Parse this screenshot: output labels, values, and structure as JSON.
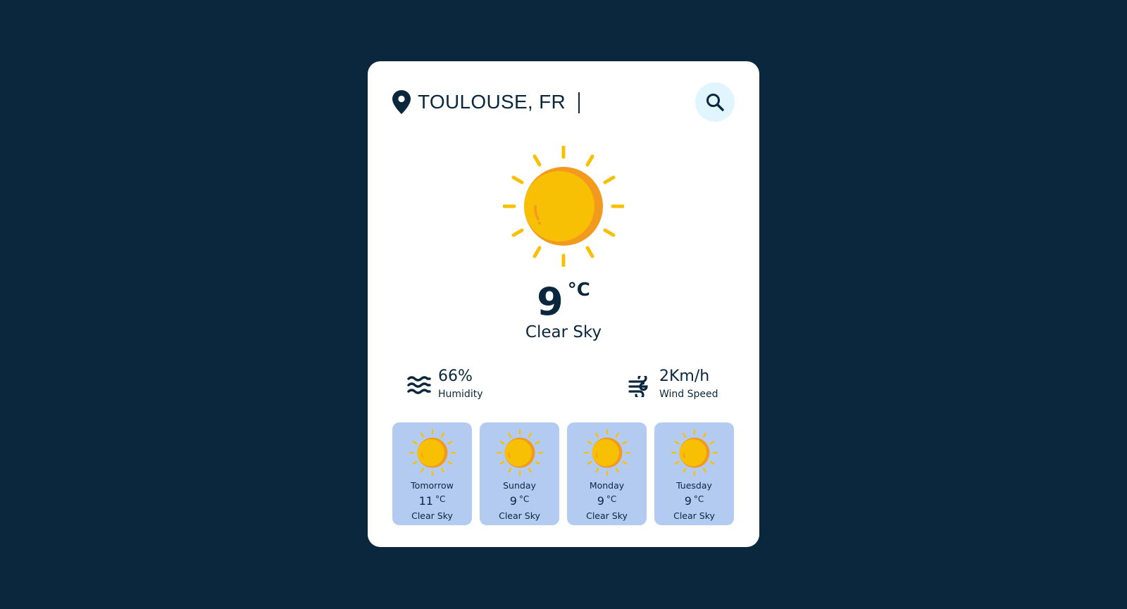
{
  "search": {
    "value": "TOULOUSE, FR",
    "button_icon": "search-icon",
    "location_icon": "map-pin-icon"
  },
  "current": {
    "icon": "sun-icon",
    "temperature": "9",
    "unit": "°C",
    "condition": "Clear Sky"
  },
  "stats": {
    "humidity": {
      "value": "66%",
      "label": "Humidity",
      "icon": "humidity-waves-icon"
    },
    "wind": {
      "value": "2Km/h",
      "label": "Wind Speed",
      "icon": "wind-icon"
    }
  },
  "forecast": [
    {
      "day": "Tomorrow",
      "temperature": "11",
      "unit": "°C",
      "condition": "Clear Sky",
      "icon": "sun-icon"
    },
    {
      "day": "Sunday",
      "temperature": "9",
      "unit": "°C",
      "condition": "Clear Sky",
      "icon": "sun-icon"
    },
    {
      "day": "Monday",
      "temperature": "9",
      "unit": "°C",
      "condition": "Clear Sky",
      "icon": "sun-icon"
    },
    {
      "day": "Tuesday",
      "temperature": "9",
      "unit": "°C",
      "condition": "Clear Sky",
      "icon": "sun-icon"
    }
  ],
  "colors": {
    "background": "#0a273e",
    "card": "#ffffff",
    "text": "#0a273e",
    "search_button": "#e0f5fd",
    "forecast_card": "#b4cbf1",
    "sun": "#f8c004",
    "sun_shade": "#f29a1d"
  }
}
